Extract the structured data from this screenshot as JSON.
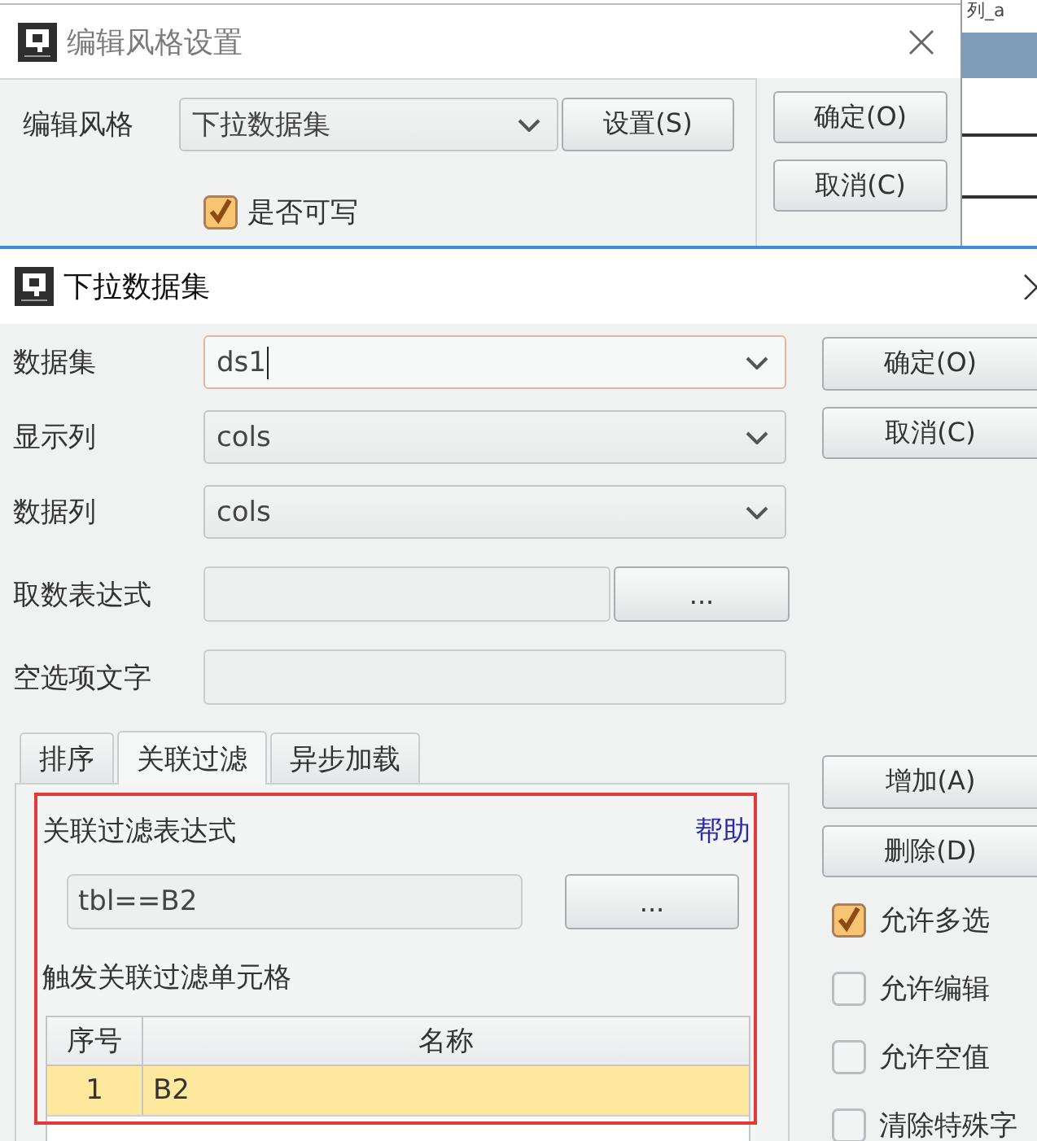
{
  "background_window": {
    "column_header": "列_a"
  },
  "style_dialog": {
    "title": "编辑风格设置",
    "edit_style": {
      "label": "编辑风格",
      "value": "下拉数据集"
    },
    "settings_button": "设置(S)",
    "writable": {
      "label": "是否可写",
      "checked": true
    },
    "buttons": [
      "确定(O)",
      "取消(C)"
    ]
  },
  "dataset_dialog": {
    "title": "下拉数据集",
    "fields": [
      {
        "kind": "combo",
        "label": "数据集",
        "value": "ds1",
        "focused": true
      },
      {
        "kind": "combo",
        "label": "显示列",
        "value": "cols",
        "focused": false
      },
      {
        "kind": "combo",
        "label": "数据列",
        "value": "cols",
        "focused": false
      },
      {
        "kind": "expression",
        "label": "取数表达式",
        "button": "..."
      },
      {
        "kind": "text",
        "label": "空选项文字"
      }
    ],
    "buttons": [
      "确定(O)",
      "取消(C)"
    ],
    "tabs": [
      {
        "label": "排序",
        "selected": false
      },
      {
        "label": "关联过滤",
        "selected": true
      },
      {
        "label": "异步加载",
        "selected": false
      }
    ],
    "filter_panel": {
      "highlighted": true,
      "expression_label": "关联过滤表达式",
      "help_link": "帮助",
      "expression": "tbl==B2",
      "expression_button": "...",
      "cells_label": "触发关联过滤单元格",
      "table": {
        "columns": [
          "序号",
          "名称"
        ],
        "rows": [
          {
            "cells": [
              "1",
              "B2"
            ],
            "selected": true
          }
        ]
      }
    },
    "side_buttons": [
      "增加(A)",
      "删除(D)"
    ],
    "options": [
      {
        "label": "允许多选",
        "checked": true
      },
      {
        "label": "允许编辑",
        "checked": false
      },
      {
        "label": "允许空值",
        "checked": false
      },
      {
        "label": "清除特殊字",
        "checked": false
      }
    ]
  }
}
